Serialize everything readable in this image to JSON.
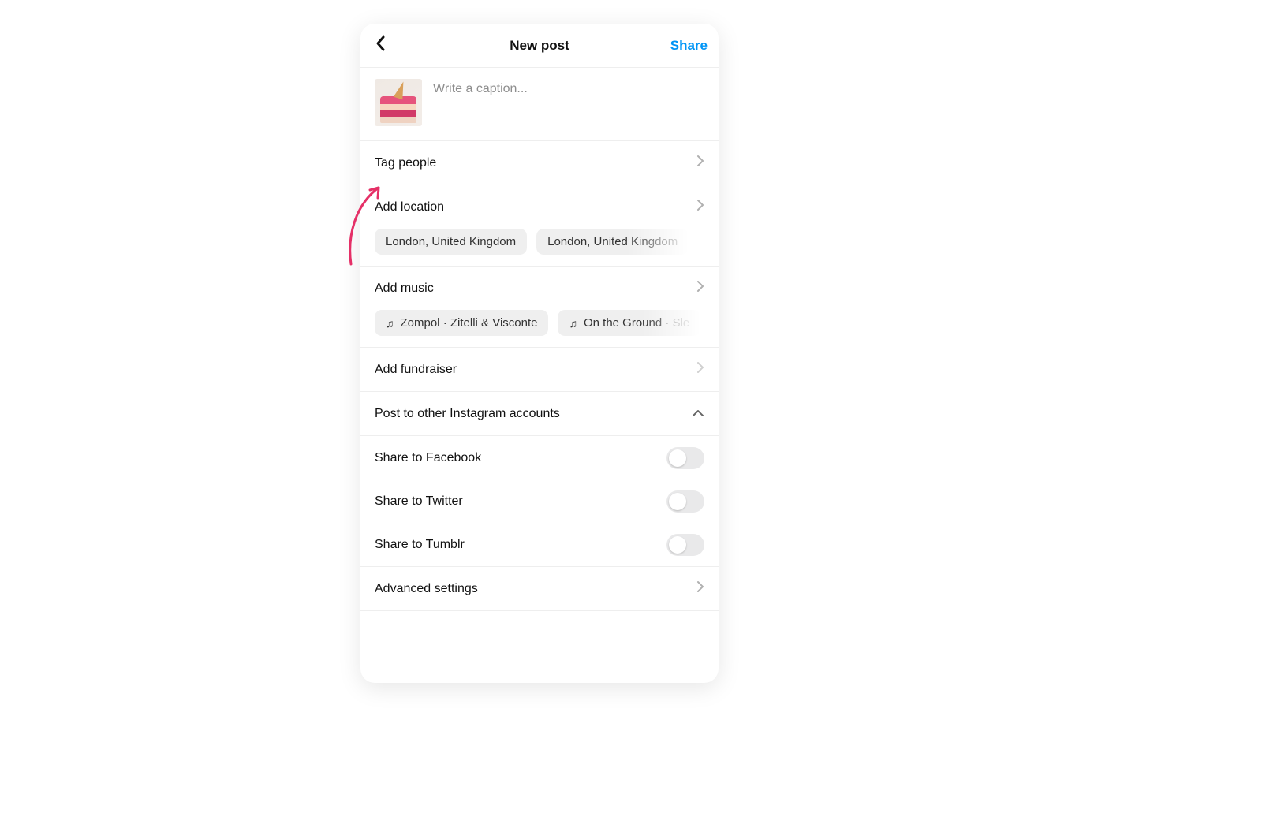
{
  "header": {
    "title": "New post",
    "share_label": "Share"
  },
  "caption": {
    "placeholder": "Write a caption..."
  },
  "rows": {
    "tag_people": "Tag people",
    "add_location": "Add location",
    "add_music": "Add music",
    "add_fundraiser": "Add fundraiser",
    "post_other_accounts": "Post to other Instagram accounts",
    "share_facebook": "Share to Facebook",
    "share_twitter": "Share to Twitter",
    "share_tumblr": "Share to Tumblr",
    "advanced_settings": "Advanced settings"
  },
  "location_suggestions": [
    "London, United Kingdom",
    "London, United Kingdom"
  ],
  "music_suggestions": [
    {
      "title": "Zompol",
      "artist": "Zitelli & Visconte"
    },
    {
      "title": "On the Ground",
      "artist": "Sle"
    }
  ],
  "colors": {
    "link": "#0095f6",
    "annotation": "#e53067"
  }
}
